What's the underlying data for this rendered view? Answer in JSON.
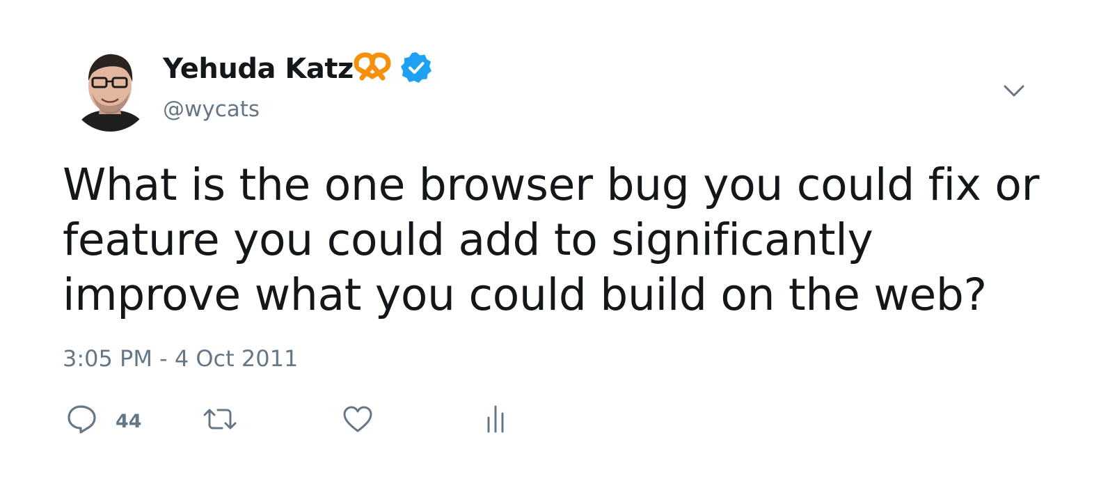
{
  "author": {
    "display_name": "Yehuda Katz",
    "handle": "@wycats",
    "verified": true,
    "emoji": "pretzel",
    "avatar_icon": "profile-photo"
  },
  "tweet": {
    "text": "What is the one browser bug you could fix or feature you could add to significantly improve what you could build on the web?",
    "timestamp": "3:05 PM - 4 Oct 2011"
  },
  "actions": {
    "reply": {
      "icon": "reply-icon",
      "count": "44"
    },
    "retweet": {
      "icon": "retweet-icon",
      "count": ""
    },
    "like": {
      "icon": "heart-icon",
      "count": ""
    },
    "analytics": {
      "icon": "analytics-icon"
    }
  },
  "menu": {
    "icon": "chevron-down-icon"
  },
  "colors": {
    "text": "#14171a",
    "secondary": "#657786",
    "verified": "#1da1f2",
    "pretzel": "#f4900c"
  }
}
